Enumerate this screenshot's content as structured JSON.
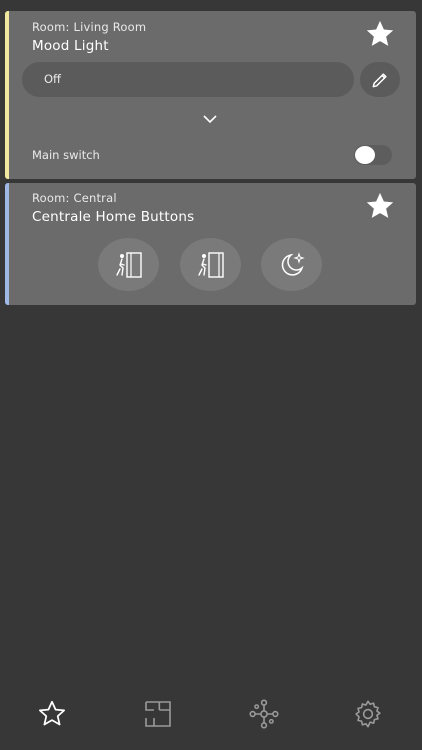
{
  "cards": [
    {
      "room": "Room: Living Room",
      "name": "Mood Light",
      "state_value": "Off",
      "switch_label": "Main switch",
      "switch_on": false,
      "stripe_color": "#f2e7a0",
      "favorite": true
    },
    {
      "room": "Room: Central",
      "name": "Centrale Home Buttons",
      "stripe_color": "#9fb8e6",
      "favorite": true,
      "scene_buttons": [
        "leave-home-icon",
        "come-home-icon",
        "night-mode-icon"
      ]
    }
  ],
  "tabbar": {
    "tabs": [
      "favorites-tab",
      "rooms-tab",
      "devices-tab",
      "settings-tab"
    ],
    "active": "favorites-tab"
  },
  "colors": {
    "background": "#373737",
    "card": "#6b6b6b",
    "pill": "#5b5b5b",
    "icon": "#ffffff",
    "inactive_icon": "#9a9a9a"
  }
}
